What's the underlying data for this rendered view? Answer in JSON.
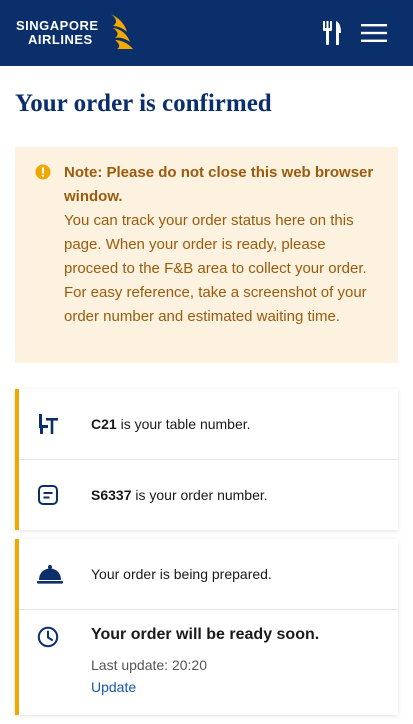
{
  "header": {
    "brand_line1": "SINGAPORE",
    "brand_line2": "AIRLINES",
    "icons": [
      "bird-logo-icon",
      "cutlery-icon",
      "hamburger-menu-icon"
    ],
    "background": "#0a2f6b"
  },
  "page": {
    "title": "Your order is confirmed"
  },
  "note": {
    "heading": "Note: Please do not close this web browser window.",
    "body": "You can track your order status here on this page. When your order is ready, please proceed to the F&B area to collect your order. For easy reference, take a screenshot of your order number and estimated waiting time.",
    "icon": "info-icon",
    "background": "#fdf1df",
    "text_color": "#9a5b0d"
  },
  "order_info": {
    "table_number": "C21",
    "table_suffix": " is your table number.",
    "order_number": "S6337",
    "order_suffix": " is your order number.",
    "icons": [
      "table-chair-icon",
      "receipt-icon"
    ]
  },
  "status": {
    "preparing_text": "Your order is being prepared.",
    "ready_title": "Your order will be ready soon.",
    "last_update": "Last update: 20:20",
    "update_link": "Update",
    "accent": "#f0a800",
    "icons": [
      "cloche-icon",
      "clock-icon"
    ]
  }
}
